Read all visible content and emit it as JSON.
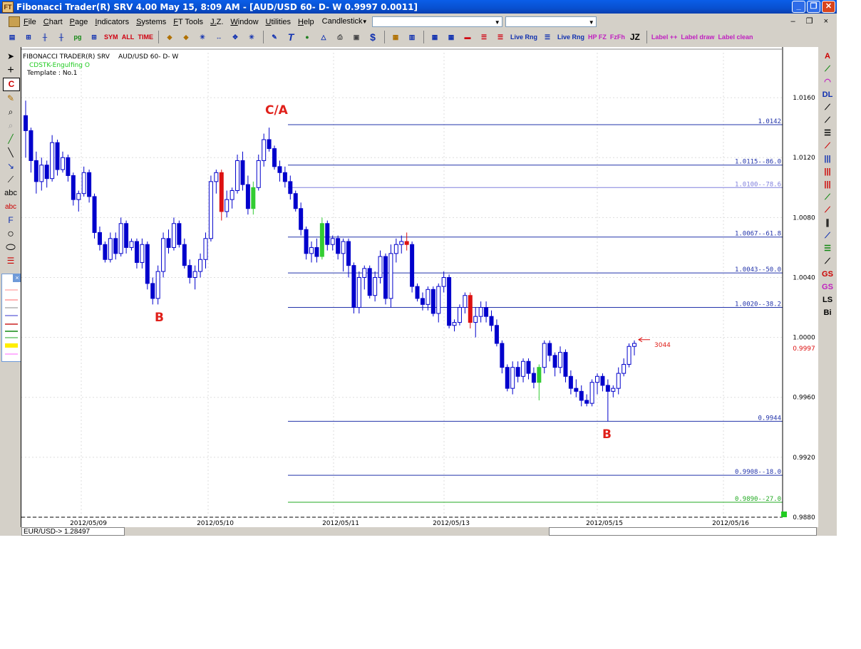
{
  "window": {
    "title": "Fibonacci Trader(R) SRV 4.00 May 15,  8:09 AM - [AUD/USD 60- D- W 0.9997  0.0011]",
    "app_icon": "FT"
  },
  "menu": {
    "items": [
      "File",
      "Chart",
      "Page",
      "Indicators",
      "Systems",
      "FT Tools",
      "J.Z.",
      "Window",
      "Utilities",
      "Help"
    ],
    "chart_type_value": "Candlestick",
    "mdi_controls": "– ❐ ×"
  },
  "toolbar": {
    "labels": [
      "Live Rng",
      "Live Rng",
      "HP FZ",
      "FzFh",
      "JZ",
      "Label ++",
      "Label draw",
      "Label clean"
    ]
  },
  "chart_header": {
    "product": "FIBONACCI TRADER(R) SRV",
    "symbol": "AUD/USD 60- D- W",
    "indicator": "CDSTK-Engulfing O",
    "template": "Template : No.1"
  },
  "annotations": {
    "ca": "C/A",
    "b_left": "B",
    "b_right": "B",
    "count": "3044"
  },
  "status": {
    "field": "EUR/USD->  1.28497"
  },
  "colors": {
    "bull": "#0000cc",
    "bear": "#0000cc",
    "engulf_bull": "#33cc33",
    "engulf_bear": "#dd1111",
    "fib_line": "#2233aa",
    "fib_light": "#8080dd",
    "fib_green": "#22aa22",
    "price_marker": "#dd1111"
  },
  "chart_data": {
    "type": "candlestick",
    "x_labels": [
      "2012/05/09",
      "2012/05/10",
      "2012/05/11",
      "2012/05/13",
      "2012/05/15",
      "2012/05/16"
    ],
    "y_ticks": [
      "1.0160",
      "1.0120",
      "1.0080",
      "1.0040",
      "1.0000",
      "0.9960",
      "0.9920",
      "0.9880"
    ],
    "ylim": [
      0.988,
      1.019
    ],
    "last_price": "0.9997",
    "fib_levels": [
      {
        "label": "1.0142",
        "value": 1.0142,
        "style": "dark"
      },
      {
        "label": "1.0115--86.0",
        "value": 1.0115,
        "style": "dark"
      },
      {
        "label": "1.0100--78.6",
        "value": 1.01,
        "style": "light"
      },
      {
        "label": "1.0067--61.8",
        "value": 1.0067,
        "style": "dark"
      },
      {
        "label": "1.0043--50.0",
        "value": 1.0043,
        "style": "dark"
      },
      {
        "label": "1.0020--38.2",
        "value": 1.002,
        "style": "dark"
      },
      {
        "label": "0.9944",
        "value": 0.9944,
        "style": "dark"
      },
      {
        "label": "0.9908--18.0",
        "value": 0.9908,
        "style": "dark"
      },
      {
        "label": "0.9890--27.0",
        "value": 0.989,
        "style": "green"
      }
    ],
    "candles": [
      [
        1.0148,
        1.0158,
        1.012,
        1.0138,
        "n"
      ],
      [
        1.0138,
        1.014,
        1.011,
        1.0118,
        "n"
      ],
      [
        1.0118,
        1.0124,
        1.0096,
        1.0104,
        "n"
      ],
      [
        1.0104,
        1.012,
        1.0098,
        1.0115,
        "n"
      ],
      [
        1.0115,
        1.0118,
        1.01,
        1.0106,
        "n"
      ],
      [
        1.0106,
        1.0135,
        1.0104,
        1.013,
        "n"
      ],
      [
        1.013,
        1.0132,
        1.0108,
        1.0112,
        "n"
      ],
      [
        1.0112,
        1.0124,
        1.011,
        1.012,
        "n"
      ],
      [
        1.012,
        1.0122,
        1.0104,
        1.0108,
        "n"
      ],
      [
        1.0108,
        1.011,
        1.0088,
        1.0092,
        "n"
      ],
      [
        1.0092,
        1.0098,
        1.0084,
        1.0096,
        "n"
      ],
      [
        1.0096,
        1.0114,
        1.0094,
        1.011,
        "n"
      ],
      [
        1.011,
        1.0112,
        1.009,
        1.0094,
        "n"
      ],
      [
        1.0094,
        1.0096,
        1.0066,
        1.007,
        "n"
      ],
      [
        1.007,
        1.0074,
        1.0058,
        1.0062,
        "n"
      ],
      [
        1.0062,
        1.0064,
        1.005,
        1.0052,
        "n"
      ],
      [
        1.0052,
        1.007,
        1.005,
        1.0066,
        "n"
      ],
      [
        1.0066,
        1.007,
        1.0052,
        1.0056,
        "n"
      ],
      [
        1.0056,
        1.008,
        1.0054,
        1.0076,
        "n"
      ],
      [
        1.0076,
        1.0078,
        1.0056,
        1.006,
        "n"
      ],
      [
        1.006,
        1.0066,
        1.0058,
        1.0064,
        "n"
      ],
      [
        1.0064,
        1.0066,
        1.0046,
        1.005,
        "n"
      ],
      [
        1.005,
        1.0066,
        1.0046,
        1.0062,
        "n"
      ],
      [
        1.0062,
        1.0064,
        1.0032,
        1.0036,
        "n"
      ],
      [
        1.0036,
        1.004,
        1.0022,
        1.0026,
        "n"
      ],
      [
        1.0026,
        1.0048,
        1.0022,
        1.0044,
        "n"
      ],
      [
        1.0044,
        1.007,
        1.004,
        1.0066,
        "n"
      ],
      [
        1.0066,
        1.0072,
        1.0056,
        1.006,
        "n"
      ],
      [
        1.006,
        1.008,
        1.0058,
        1.0076,
        "n"
      ],
      [
        1.0076,
        1.0078,
        1.006,
        1.0062,
        "n"
      ],
      [
        1.0062,
        1.0066,
        1.0046,
        1.0048,
        "n"
      ],
      [
        1.0048,
        1.0052,
        1.0036,
        1.004,
        "n"
      ],
      [
        1.004,
        1.0048,
        1.0032,
        1.0044,
        "n"
      ],
      [
        1.0044,
        1.0056,
        1.004,
        1.0052,
        "n"
      ],
      [
        1.0052,
        1.007,
        1.0046,
        1.0066,
        "n"
      ],
      [
        1.0066,
        1.0108,
        1.0064,
        1.0104,
        "n"
      ],
      [
        1.0104,
        1.0112,
        1.0096,
        1.011,
        "n"
      ],
      [
        1.011,
        1.0112,
        1.0078,
        1.0084,
        "r"
      ],
      [
        1.0084,
        1.0098,
        1.008,
        1.0092,
        "n"
      ],
      [
        1.0092,
        1.01,
        1.0086,
        1.0098,
        "n"
      ],
      [
        1.0098,
        1.0122,
        1.0096,
        1.0118,
        "n"
      ],
      [
        1.0118,
        1.0124,
        1.0098,
        1.0102,
        "n"
      ],
      [
        1.0102,
        1.0108,
        1.0082,
        1.0086,
        "n"
      ],
      [
        1.0086,
        1.0104,
        1.0082,
        1.01,
        "g"
      ],
      [
        1.01,
        1.0122,
        1.0098,
        1.0118,
        "n"
      ],
      [
        1.0118,
        1.0136,
        1.0114,
        1.0132,
        "n"
      ],
      [
        1.0132,
        1.014,
        1.0124,
        1.0126,
        "n"
      ],
      [
        1.0126,
        1.0128,
        1.0112,
        1.0114,
        "n"
      ],
      [
        1.0114,
        1.0118,
        1.0104,
        1.011,
        "n"
      ],
      [
        1.011,
        1.0114,
        1.01,
        1.0104,
        "n"
      ],
      [
        1.0104,
        1.0108,
        1.0092,
        1.0096,
        "n"
      ],
      [
        1.0096,
        1.0098,
        1.0084,
        1.0086,
        "n"
      ],
      [
        1.0086,
        1.009,
        1.0068,
        1.0072,
        "n"
      ],
      [
        1.0072,
        1.0074,
        1.0052,
        1.0056,
        "n"
      ],
      [
        1.0056,
        1.0064,
        1.005,
        1.006,
        "n"
      ],
      [
        1.006,
        1.0066,
        1.005,
        1.0054,
        "n"
      ],
      [
        1.0054,
        1.008,
        1.0052,
        1.0076,
        "g"
      ],
      [
        1.0076,
        1.0078,
        1.0058,
        1.0062,
        "n"
      ],
      [
        1.0062,
        1.0068,
        1.0058,
        1.0066,
        "n"
      ],
      [
        1.0066,
        1.0068,
        1.0052,
        1.0056,
        "n"
      ],
      [
        1.0056,
        1.0066,
        1.0044,
        1.0064,
        "n"
      ],
      [
        1.0064,
        1.0066,
        1.004,
        1.0048,
        "n"
      ],
      [
        1.0048,
        1.005,
        1.0016,
        1.002,
        "n"
      ],
      [
        1.002,
        1.0044,
        1.0016,
        1.004,
        "n"
      ],
      [
        1.004,
        1.0048,
        1.0032,
        1.0046,
        "n"
      ],
      [
        1.0046,
        1.0048,
        1.0026,
        1.0028,
        "n"
      ],
      [
        1.0028,
        1.0044,
        1.0024,
        1.004,
        "n"
      ],
      [
        1.004,
        1.0058,
        1.0036,
        1.0054,
        "n"
      ],
      [
        1.0054,
        1.0056,
        1.0022,
        1.0026,
        "n"
      ],
      [
        1.0026,
        1.0062,
        1.002,
        1.0056,
        "n"
      ],
      [
        1.0056,
        1.0066,
        1.005,
        1.0062,
        "n"
      ],
      [
        1.0062,
        1.0068,
        1.0056,
        1.0064,
        "n"
      ],
      [
        1.0064,
        1.007,
        1.0058,
        1.0062,
        "r"
      ],
      [
        1.0062,
        1.0064,
        1.003,
        1.0034,
        "n"
      ],
      [
        1.0034,
        1.0036,
        1.0024,
        1.0026,
        "n"
      ],
      [
        1.0026,
        1.003,
        1.0018,
        1.0022,
        "n"
      ],
      [
        1.0022,
        1.0034,
        1.0018,
        1.0032,
        "n"
      ],
      [
        1.0032,
        1.0034,
        1.0014,
        1.0016,
        "n"
      ],
      [
        1.0016,
        1.0036,
        1.001,
        1.0034,
        "n"
      ],
      [
        1.0034,
        1.0044,
        1.003,
        1.004,
        "n"
      ],
      [
        1.004,
        1.0042,
        1.0006,
        1.0008,
        "n"
      ],
      [
        1.0008,
        1.0012,
        1.0004,
        1.001,
        "n"
      ],
      [
        1.001,
        1.0022,
        1.0008,
        1.002,
        "n"
      ],
      [
        1.002,
        1.003,
        1.0016,
        1.0028,
        "n"
      ],
      [
        1.0028,
        1.003,
        1.0006,
        1.001,
        "r"
      ],
      [
        1.001,
        1.002,
        1.0,
        1.0014,
        "n"
      ],
      [
        1.0014,
        1.0024,
        1.001,
        1.002,
        "n"
      ],
      [
        1.002,
        1.0024,
        1.001,
        1.0014,
        "n"
      ],
      [
        1.0014,
        1.0018,
        1.0004,
        1.0008,
        "n"
      ],
      [
        1.0008,
        1.0012,
        0.9994,
        0.9996,
        "n"
      ],
      [
        0.9996,
        0.9998,
        0.9976,
        0.998,
        "n"
      ],
      [
        0.998,
        0.9982,
        0.9964,
        0.9966,
        "n"
      ],
      [
        0.9966,
        0.9984,
        0.9962,
        0.998,
        "n"
      ],
      [
        0.998,
        0.9984,
        0.997,
        0.9974,
        "n"
      ],
      [
        0.9974,
        0.9986,
        0.997,
        0.9984,
        "n"
      ],
      [
        0.9984,
        0.9986,
        0.9972,
        0.9976,
        "n"
      ],
      [
        0.9976,
        0.998,
        0.9966,
        0.997,
        "n"
      ],
      [
        0.997,
        0.9982,
        0.9958,
        0.998,
        "g"
      ],
      [
        0.998,
        0.9998,
        0.9976,
        0.9996,
        "n"
      ],
      [
        0.9996,
        0.9998,
        0.9984,
        0.9988,
        "n"
      ],
      [
        0.9988,
        0.999,
        0.9974,
        0.998,
        "n"
      ],
      [
        0.998,
        0.9994,
        0.9976,
        0.999,
        "n"
      ],
      [
        0.999,
        0.9992,
        0.997,
        0.9974,
        "n"
      ],
      [
        0.9974,
        0.9978,
        0.9962,
        0.9966,
        "n"
      ],
      [
        0.9966,
        0.9972,
        0.996,
        0.9964,
        "n"
      ],
      [
        0.9964,
        0.9968,
        0.9954,
        0.9958,
        "n"
      ],
      [
        0.9958,
        0.9962,
        0.9954,
        0.9956,
        "n"
      ],
      [
        0.9956,
        0.9972,
        0.9954,
        0.997,
        "n"
      ],
      [
        0.997,
        0.9976,
        0.9962,
        0.9974,
        "n"
      ],
      [
        0.9974,
        0.9976,
        0.9964,
        0.9968,
        "n"
      ],
      [
        0.9968,
        0.9972,
        0.9944,
        0.9964,
        "n"
      ],
      [
        0.9964,
        0.9968,
        0.996,
        0.9966,
        "n"
      ],
      [
        0.9966,
        0.998,
        0.9962,
        0.9976,
        "n"
      ],
      [
        0.9976,
        0.9986,
        0.9974,
        0.9982,
        "n"
      ],
      [
        0.9982,
        0.9996,
        0.998,
        0.9994,
        "n"
      ],
      [
        0.9994,
        0.9998,
        0.9988,
        0.9996,
        "n"
      ]
    ]
  }
}
